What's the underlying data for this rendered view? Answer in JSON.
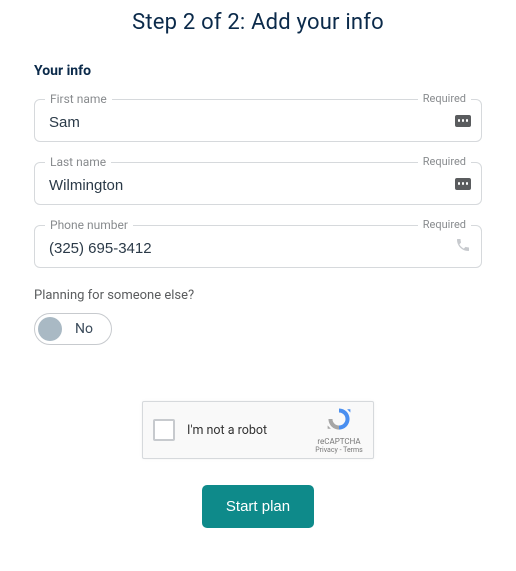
{
  "title": "Step 2 of 2: Add your info",
  "section": "Your info",
  "required_label": "Required",
  "fields": {
    "first_name": {
      "label": "First name",
      "value": "Sam"
    },
    "last_name": {
      "label": "Last name",
      "value": "Wilmington"
    },
    "phone": {
      "label": "Phone number",
      "value": "(325) 695-3412"
    }
  },
  "planning_question": "Planning for someone else?",
  "toggle": {
    "label": "No"
  },
  "captcha": {
    "text": "I'm not a robot",
    "brand": "reCAPTCHA",
    "links": "Privacy - Terms"
  },
  "cta": "Start plan"
}
